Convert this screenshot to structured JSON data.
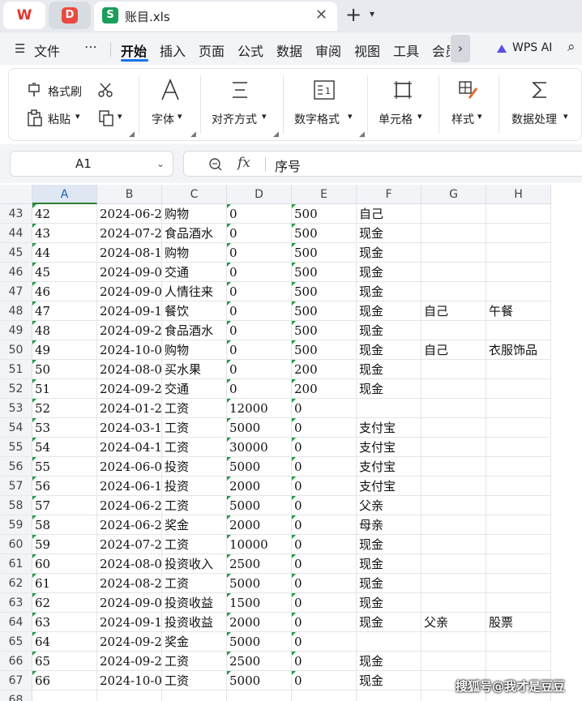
{
  "tabs": {
    "wps_label": "W",
    "second_label": "D",
    "doc_icon": "S",
    "doc_title": "账目.xls",
    "close": "✕",
    "plus": "+",
    "chevron": "⌄"
  },
  "menu": {
    "hamburger": "☰",
    "file": "文件",
    "more": "⋯",
    "items": [
      "开始",
      "插入",
      "页面",
      "公式",
      "数据",
      "审阅",
      "视图",
      "工具",
      "会员"
    ],
    "active_index": 0,
    "next_arrow": "›",
    "wps_ai": "WPS AI",
    "search_icon": "search-icon"
  },
  "ribbon": {
    "format_painter": "格式刷",
    "paste": "粘贴",
    "font": "字体",
    "align": "对齐方式",
    "number_format": "数字格式",
    "cell": "单元格",
    "style": "样式",
    "data_processing": "数据处理",
    "dropdown": "▾"
  },
  "formula_bar": {
    "name_box": "A1",
    "formula": "序号"
  },
  "grid": {
    "columns": [
      "A",
      "B",
      "C",
      "D",
      "E",
      "F",
      "G",
      "H"
    ],
    "selected_column": "A",
    "rows": [
      {
        "n": "43",
        "cells": [
          "42",
          "2024-06-2",
          "购物",
          "0",
          "500",
          "自己",
          "",
          ""
        ]
      },
      {
        "n": "44",
        "cells": [
          "43",
          "2024-07-2",
          "食品酒水",
          "0",
          "500",
          "现金",
          "",
          ""
        ]
      },
      {
        "n": "45",
        "cells": [
          "44",
          "2024-08-1",
          "购物",
          "0",
          "500",
          "现金",
          "",
          ""
        ]
      },
      {
        "n": "46",
        "cells": [
          "45",
          "2024-09-0",
          "交通",
          "0",
          "500",
          "现金",
          "",
          ""
        ]
      },
      {
        "n": "47",
        "cells": [
          "46",
          "2024-09-0",
          "人情往来",
          "0",
          "500",
          "现金",
          "",
          ""
        ]
      },
      {
        "n": "48",
        "cells": [
          "47",
          "2024-09-1",
          "餐饮",
          "0",
          "500",
          "现金",
          "自己",
          "午餐"
        ]
      },
      {
        "n": "49",
        "cells": [
          "48",
          "2024-09-2",
          "食品酒水",
          "0",
          "500",
          "现金",
          "",
          ""
        ]
      },
      {
        "n": "50",
        "cells": [
          "49",
          "2024-10-0",
          "购物",
          "0",
          "500",
          "现金",
          "自己",
          "衣服饰品"
        ]
      },
      {
        "n": "51",
        "cells": [
          "50",
          "2024-08-0",
          "买水果",
          "0",
          "200",
          "现金",
          "",
          ""
        ]
      },
      {
        "n": "52",
        "cells": [
          "51",
          "2024-09-2",
          "交通",
          "0",
          "200",
          "现金",
          "",
          ""
        ]
      },
      {
        "n": "53",
        "cells": [
          "52",
          "2024-01-2",
          "工资",
          "12000",
          "0",
          "",
          "",
          ""
        ]
      },
      {
        "n": "54",
        "cells": [
          "53",
          "2024-03-1",
          "工资",
          "5000",
          "0",
          "支付宝",
          "",
          ""
        ]
      },
      {
        "n": "55",
        "cells": [
          "54",
          "2024-04-1",
          "工资",
          "30000",
          "0",
          "支付宝",
          "",
          ""
        ]
      },
      {
        "n": "56",
        "cells": [
          "55",
          "2024-06-0",
          "投资",
          "5000",
          "0",
          "支付宝",
          "",
          ""
        ]
      },
      {
        "n": "57",
        "cells": [
          "56",
          "2024-06-1",
          "投资",
          "2000",
          "0",
          "支付宝",
          "",
          ""
        ]
      },
      {
        "n": "58",
        "cells": [
          "57",
          "2024-06-2",
          "工资",
          "5000",
          "0",
          "父亲",
          "",
          ""
        ]
      },
      {
        "n": "59",
        "cells": [
          "58",
          "2024-06-2",
          "奖金",
          "2000",
          "0",
          "母亲",
          "",
          ""
        ]
      },
      {
        "n": "60",
        "cells": [
          "59",
          "2024-07-2",
          "工资",
          "10000",
          "0",
          "现金",
          "",
          ""
        ]
      },
      {
        "n": "61",
        "cells": [
          "60",
          "2024-08-0",
          "投资收入",
          "2500",
          "0",
          "现金",
          "",
          ""
        ]
      },
      {
        "n": "62",
        "cells": [
          "61",
          "2024-08-2",
          "工资",
          "5000",
          "0",
          "现金",
          "",
          ""
        ]
      },
      {
        "n": "63",
        "cells": [
          "62",
          "2024-09-0",
          "投资收益",
          "1500",
          "0",
          "现金",
          "",
          ""
        ]
      },
      {
        "n": "64",
        "cells": [
          "63",
          "2024-09-1",
          "投资收益",
          "2000",
          "0",
          "现金",
          "父亲",
          "股票"
        ]
      },
      {
        "n": "65",
        "cells": [
          "64",
          "2024-09-2",
          "奖金",
          "5000",
          "0",
          "",
          "",
          ""
        ]
      },
      {
        "n": "66",
        "cells": [
          "65",
          "2024-09-2",
          "工资",
          "2500",
          "0",
          "现金",
          "",
          ""
        ]
      },
      {
        "n": "67",
        "cells": [
          "66",
          "2024-10-0",
          "工资",
          "5000",
          "0",
          "现金",
          "",
          ""
        ]
      },
      {
        "n": "68",
        "cells": [
          "",
          "",
          "",
          "",
          "",
          "",
          "",
          ""
        ]
      }
    ]
  },
  "watermark": "搜狐号@我才是豆豆",
  "colors": {
    "accent": "#1a73e8",
    "sheet_green": "#1b9e5a",
    "marker_green": "#1f9b3d"
  }
}
